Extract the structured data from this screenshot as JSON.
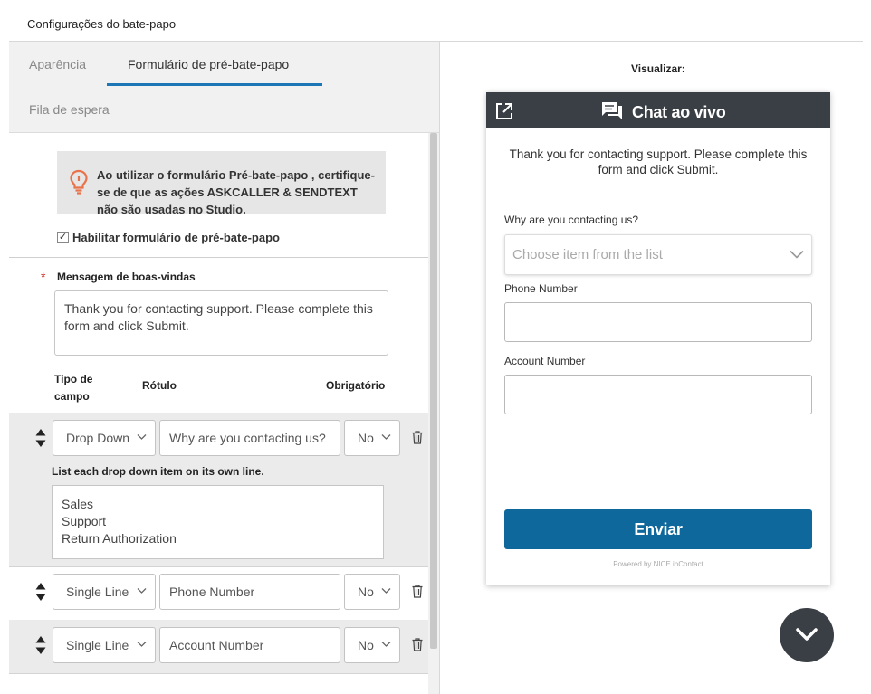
{
  "page": {
    "title": "Configurações do bate-papo"
  },
  "tabs": {
    "appearance": "Aparência",
    "prechat_form": "Formulário de pré-bate-papo",
    "queue": "Fila de espera"
  },
  "notice": {
    "text": "Ao utilizar o formulário Pré-bate-papo , certifique-se de que as ações ASKCALLER & SENDTEXT não são usadas no Studio.",
    "icon": "lightbulb-icon"
  },
  "enable": {
    "checkbox_mark": "✓",
    "label": "Habilitar formulário de pré-bate-papo"
  },
  "welcome": {
    "required_mark": "*",
    "label": "Mensagem de boas-vindas",
    "text": "Thank you for contacting support. Please complete this form and click Submit."
  },
  "columns": {
    "type": "Tipo de campo",
    "label": "Rótulo",
    "required": "Obrigatório"
  },
  "fields": [
    {
      "type": "Drop Down",
      "label": "Why are you contacting us?",
      "required": "No"
    },
    {
      "type": "Single Line",
      "label": "Phone Number",
      "required": "No"
    },
    {
      "type": "Single Line",
      "label": "Account Number",
      "required": "No"
    }
  ],
  "dropdown_items": {
    "hint": "List each drop down item on its own line.",
    "lines": [
      "Sales",
      "Support",
      "Return Authorization"
    ]
  },
  "preview": {
    "title": "Visualizar:",
    "header_title": "Chat ao vivo",
    "intro": "Thank you for contacting support. Please complete this form and click Submit.",
    "field1_label": "Why are you contacting us?",
    "field1_placeholder": "Choose item from the list",
    "field2_label": "Phone Number",
    "field3_label": "Account Number",
    "submit": "Enviar",
    "powered_by": "Powered by NICE inContact"
  },
  "colors": {
    "accent": "#1d76b5",
    "header": "#3a3f45",
    "submit": "#0e689c",
    "notice_icon": "#e8734a",
    "required": "#d0342c"
  }
}
